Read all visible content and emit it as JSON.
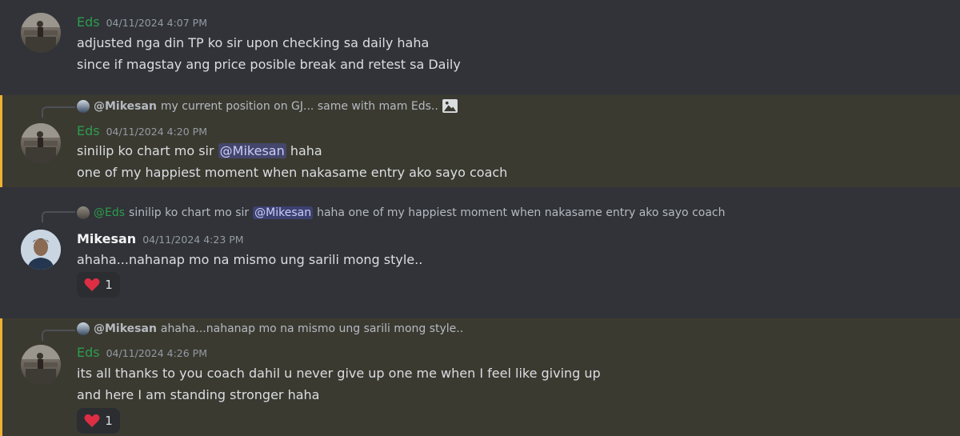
{
  "messages": [
    {
      "author": "Eds",
      "timestamp": "04/11/2024 4:07 PM",
      "lines": [
        "adjusted nga din TP ko sir upon checking sa daily haha",
        "since if magstay ang price posible break and retest sa Daily"
      ]
    },
    {
      "reply": {
        "author": "@Mikesan",
        "text": "my current position on GJ... same with mam Eds..",
        "icon": "image-icon"
      },
      "author": "Eds",
      "timestamp": "04/11/2024 4:20 PM",
      "line1_prefix": "sinilip ko chart mo sir",
      "line1_mention": "@Mikesan",
      "line1_suffix": "haha",
      "line2": "one of my happiest moment when nakasame entry ako sayo coach"
    },
    {
      "reply": {
        "author": "@Eds",
        "text_prefix": "sinilip ko chart mo sir",
        "mention": "@Mikesan",
        "text_suffix": "haha one of my happiest moment when nakasame entry ako sayo coach"
      },
      "author": "Mikesan",
      "timestamp": "04/11/2024 4:23 PM",
      "line1": "ahaha...nahanap mo na mismo ung sarili mong style..",
      "reaction": {
        "emoji": "heart-icon",
        "count": "1"
      }
    },
    {
      "reply": {
        "author": "@Mikesan",
        "text": "ahaha...nahanap mo na mismo ung sarili mong style.."
      },
      "author": "Eds",
      "timestamp": "04/11/2024 4:26 PM",
      "line1": "its all thanks to you coach dahil u never give up one me when I feel like giving up",
      "line2": "and here I am standing stronger  haha",
      "reaction": {
        "emoji": "heart-icon",
        "count": "1"
      }
    }
  ],
  "colors": {
    "background": "#313338",
    "mention_highlight": "#3b3a31",
    "mention_bar": "#f0b132",
    "eds_name": "#2c9c4d"
  }
}
